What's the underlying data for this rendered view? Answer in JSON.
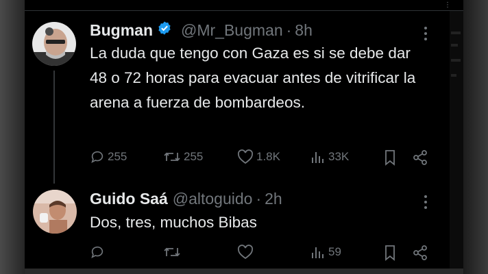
{
  "tweets": [
    {
      "name": "Bugman",
      "handle": "@Mr_Bugman",
      "time": "8h",
      "text": "La duda que tengo con Gaza es si se debe dar 48 o 72 horas para evacuar antes de vitrificar la arena a fuerza de bombardeos.",
      "replies": "255",
      "retweets": "255",
      "likes": "1.8K",
      "views": "33K"
    },
    {
      "name": "Guido Saá",
      "handle": "@altoguido",
      "time": "2h",
      "text": "Dos, tres, muchos Bibas",
      "replies": "",
      "retweets": "",
      "likes": "",
      "views": "59"
    }
  ],
  "separator": "·",
  "colors": {
    "background": "#000000",
    "primary_text": "#e7e9ea",
    "secondary_text": "#71767b",
    "verified_badge": "#1d9bf0"
  },
  "icons": [
    "verified-badge-icon",
    "more-icon",
    "reply-icon",
    "retweet-icon",
    "like-icon",
    "views-icon",
    "bookmark-icon",
    "share-icon"
  ]
}
